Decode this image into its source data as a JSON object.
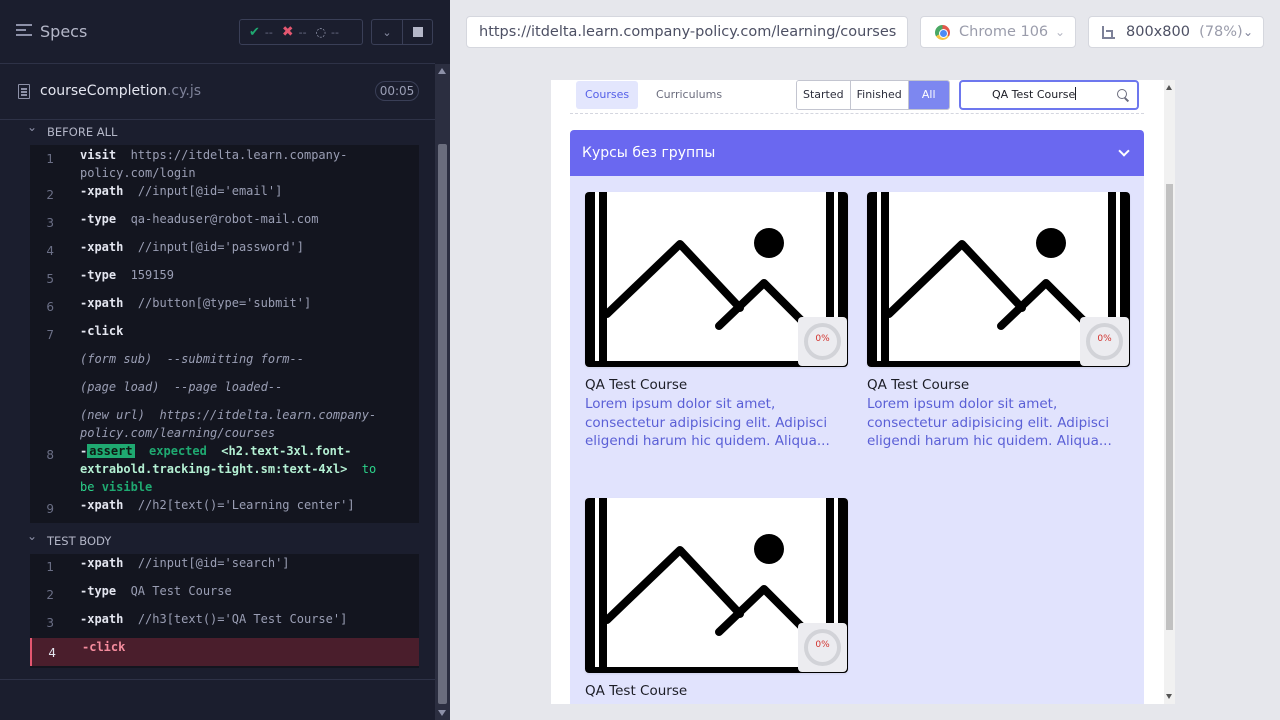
{
  "reporter": {
    "title": "Specs",
    "stats": {
      "passed": "--",
      "failed": "--",
      "pending": "--"
    },
    "file": {
      "name": "courseCompletion",
      "ext": ".cy.js",
      "duration": "00:05"
    },
    "before_all": {
      "label": "BEFORE ALL",
      "commands": [
        {
          "num": "1",
          "name": "visit",
          "message": "https://itdelta.learn.company-policy.com/login"
        },
        {
          "num": "2",
          "name": "-xpath",
          "message": "//input[@id='email']"
        },
        {
          "num": "3",
          "name": "-type",
          "message": "qa-headuser@robot-mail.com"
        },
        {
          "num": "4",
          "name": "-xpath",
          "message": "//input[@id='password']"
        },
        {
          "num": "5",
          "name": "-type",
          "message": "159159"
        },
        {
          "num": "6",
          "name": "-xpath",
          "message": "//button[@type='submit']"
        },
        {
          "num": "7",
          "name": "-click",
          "message": ""
        }
      ],
      "events": [
        {
          "label": "(form sub)",
          "message": "--submitting form--"
        },
        {
          "label": "(page load)",
          "message": "--page loaded--"
        },
        {
          "label": "(new url)",
          "message": "https://itdelta.learn.company-policy.com/learning/courses"
        }
      ],
      "assert": {
        "num": "8",
        "dash": "-",
        "badge": "assert",
        "expected": "expected",
        "selector": "<h2.text-3xl.font-extrabold.tracking-tight.sm:text-4xl>",
        "to_be": "to be",
        "visible": "visible"
      },
      "last": {
        "num": "9",
        "name": "-xpath",
        "message": "//h2[text()='Learning center']"
      }
    },
    "test_body": {
      "label": "TEST BODY",
      "commands": [
        {
          "num": "1",
          "name": "-xpath",
          "message": "//input[@id='search']"
        },
        {
          "num": "2",
          "name": "-type",
          "message": "QA Test Course"
        },
        {
          "num": "3",
          "name": "-xpath",
          "message": "//h3[text()='QA Test Course']"
        },
        {
          "num": "4",
          "name": "-click",
          "message": ""
        }
      ]
    }
  },
  "browser": {
    "url": "https://itdelta.learn.company-policy.com/learning/courses",
    "name": "Chrome 106",
    "viewport": "800x800",
    "zoom": "(78%)"
  },
  "app": {
    "tabs": [
      "Courses",
      "Curriculums"
    ],
    "filters": [
      "Started",
      "Finished",
      "All"
    ],
    "active_filter": "All",
    "search_value": "QA Test Course",
    "group_title": "Курсы без группы",
    "courses": [
      {
        "title": "QA Test Course",
        "description": "Lorem ipsum dolor sit amet, consectetur adipisicing elit. Adipisci eligendi harum hic quidem. Aliqua...",
        "progress": "0%"
      },
      {
        "title": "QA Test Course",
        "description": "Lorem ipsum dolor sit amet, consectetur adipisicing elit. Adipisci eligendi harum hic quidem. Aliqua...",
        "progress": "0%"
      },
      {
        "title": "QA Test Course",
        "description": "",
        "progress": "0%"
      }
    ],
    "accent": "#6a68f0"
  }
}
